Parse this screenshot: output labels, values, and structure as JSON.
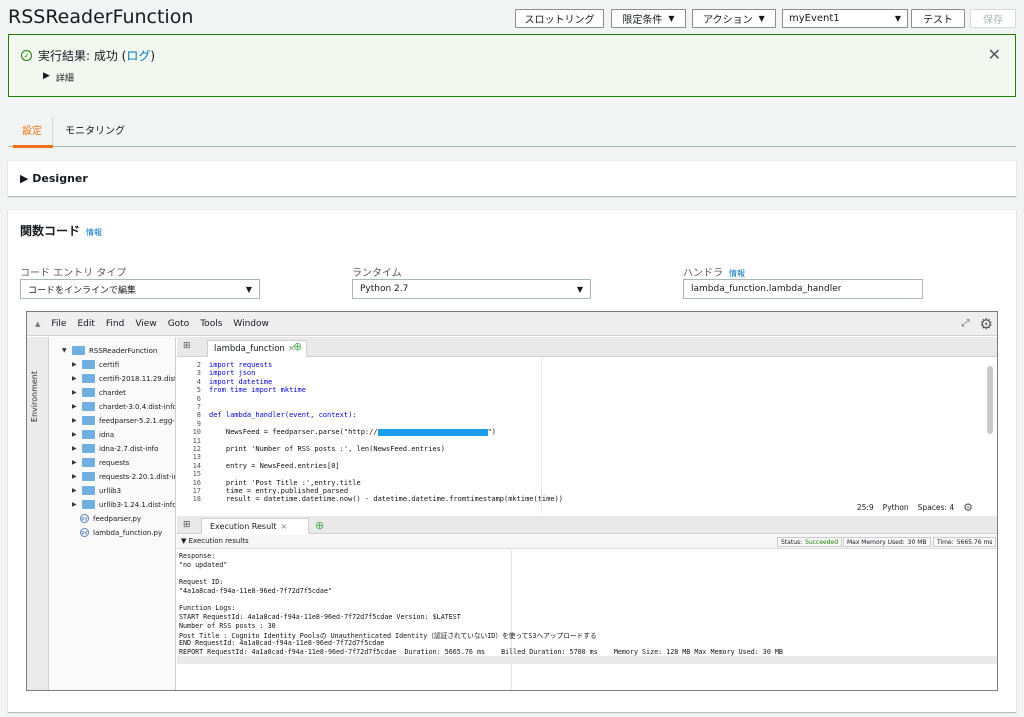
{
  "header": {
    "title": "RSSReaderFunction",
    "throttle_label": "スロットリング",
    "qualifier_label": "限定条件",
    "actions_label": "アクション",
    "test_event": "myEvent1",
    "test_label": "テスト",
    "save_label": "保存"
  },
  "result_banner": {
    "prefix": "実行結果: 成功 (",
    "log_link": "ログ",
    "suffix": ")",
    "details_label": "詳細",
    "close": "✕"
  },
  "tabs": [
    "設定",
    "モニタリング"
  ],
  "designer": {
    "label": "Designer"
  },
  "function_code": {
    "heading": "関数コード",
    "info": "情報",
    "entry_type_label": "コード エントリ タイプ",
    "entry_type_value": "コードをインラインで編集",
    "runtime_label": "ランタイム",
    "runtime_value": "Python 2.7",
    "handler_label": "ハンドラ",
    "handler_info": "情報",
    "handler_value": "lambda_function.lambda_handler"
  },
  "ide": {
    "menu": [
      "File",
      "Edit",
      "Find",
      "View",
      "Goto",
      "Tools",
      "Window"
    ],
    "environment_label": "Environment",
    "tree_root": "RSSReaderFunction",
    "tree_items": [
      "certifi",
      "certifi-2018.11.29.dist-info",
      "chardet",
      "chardet-3.0.4.dist-info",
      "feedparser-5.2.1.egg-info",
      "idna",
      "idna-2.7.dist-info",
      "requests",
      "requests-2.20.1.dist-info",
      "urllib3",
      "urllib3-1.24.1.dist-info"
    ],
    "tree_files": [
      "feedparser.py",
      "lambda_function.py"
    ],
    "editor_tab": "lambda_function",
    "code_lines": [
      {
        "n": "2",
        "t": "import requests"
      },
      {
        "n": "3",
        "t": "import json"
      },
      {
        "n": "4",
        "t": "import datetime"
      },
      {
        "n": "5",
        "t": "from time import mktime"
      },
      {
        "n": "6",
        "t": ""
      },
      {
        "n": "7",
        "t": ""
      },
      {
        "n": "8",
        "t": "def lambda_handler(event, context):"
      },
      {
        "n": "9",
        "t": ""
      },
      {
        "n": "10",
        "t": "    NewsFeed = feedparser.parse(\"http://"
      },
      {
        "n": "11",
        "t": ""
      },
      {
        "n": "12",
        "t": "    print 'Number of RSS posts :', len(NewsFeed.entries)"
      },
      {
        "n": "13",
        "t": ""
      },
      {
        "n": "14",
        "t": "    entry = NewsFeed.entries[0]"
      },
      {
        "n": "15",
        "t": ""
      },
      {
        "n": "16",
        "t": "    print 'Post Title :',entry.title"
      },
      {
        "n": "17",
        "t": "    time = entry.published_parsed"
      },
      {
        "n": "18",
        "t": "    result = datetime.datetime.now() - datetime.datetime.fromtimestamp(mktime(time))"
      }
    ],
    "line10_end": "\")",
    "cursor_pos": "25:9",
    "language": "Python",
    "spaces": "Spaces: 4",
    "result_tab": "Execution Result",
    "exec_results_label": "Execution results",
    "status_label": "Status:",
    "status_value": "Succeeded",
    "max_memory_label": "Max Memory Used:",
    "max_memory_value": "30 MB",
    "time_label": "Time:",
    "time_value": "5665.76 ms",
    "output_lines": [
      "Response:",
      "\"no updated\"",
      "",
      "Request ID:",
      "\"4a1a8cad-f94a-11e8-96ed-7f72d7f5cdae\"",
      "",
      "Function Logs:",
      "START RequestId: 4a1a8cad-f94a-11e8-96ed-7f72d7f5cdae Version: $LATEST",
      "Number of RSS posts : 30",
      "Post Title : Cognito Identity Poolsの Unauthenticated Identity（認証されていないID）を使ってS3へアップロードする",
      "END RequestId: 4a1a8cad-f94a-11e8-96ed-7f72d7f5cdae",
      "REPORT RequestId: 4a1a8cad-f94a-11e8-96ed-7f72d7f5cdae  Duration: 5665.76 ms    Billed Duration: 5700 ms    Memory Size: 128 MB Max Memory Used: 30 MB"
    ]
  }
}
